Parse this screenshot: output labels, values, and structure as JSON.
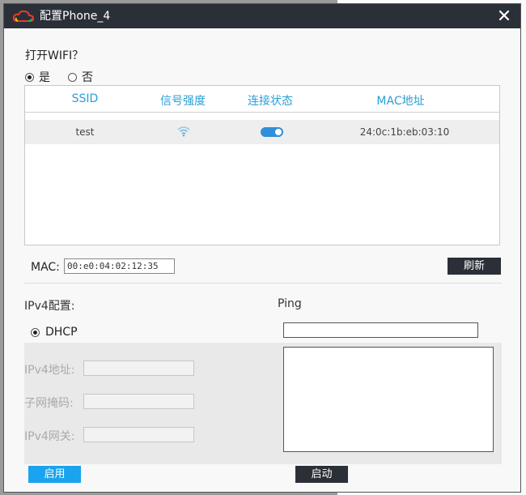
{
  "window": {
    "title": "配置Phone_4"
  },
  "wifi": {
    "question": "打开WIFI？",
    "options": [
      {
        "label": "是",
        "selected": true
      },
      {
        "label": "否",
        "selected": false
      }
    ],
    "columns": [
      "SSID",
      "信号强度",
      "连接状态",
      "MAC地址"
    ],
    "rows": [
      {
        "ssid": "test",
        "signal_icon": "wifi-signal-icon",
        "connected": true,
        "mac": "24:0c:1b:eb:03:10"
      }
    ]
  },
  "mac": {
    "label": "MAC:",
    "value": "00:e0:04:02:12:35"
  },
  "refresh_label": "刷新",
  "ipv4": {
    "title": "IPv4配置:",
    "dhcp_label": "DHCP",
    "dhcp_selected": true,
    "address_label": "IPv4地址:",
    "mask_label": "子网掩码:",
    "gateway_label": "IPv4网关:",
    "address_value": "",
    "mask_value": "",
    "gateway_value": ""
  },
  "ping": {
    "title": "Ping",
    "target": "",
    "output": ""
  },
  "buttons": {
    "apply": "启用",
    "start": "启动"
  },
  "colors": {
    "titlebar": "#2b2f38",
    "accent": "#2a9fd6",
    "apply_button": "#1aa3ee",
    "toggle_on": "#2f8fd8"
  }
}
